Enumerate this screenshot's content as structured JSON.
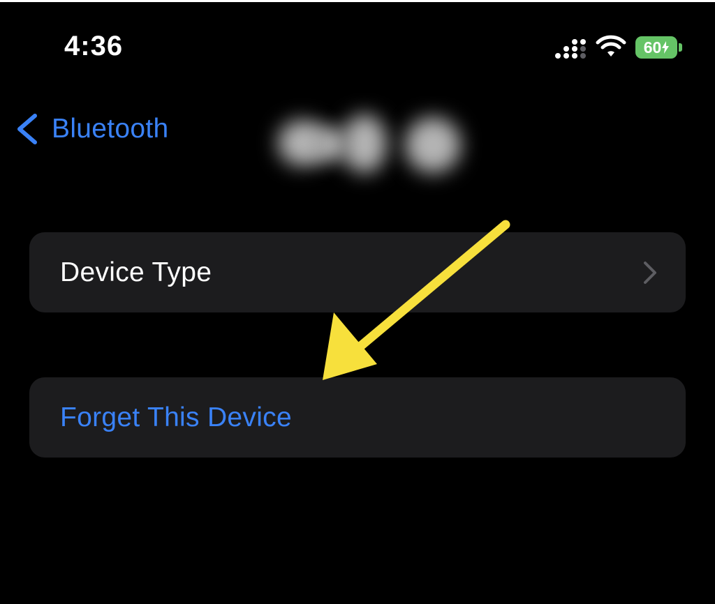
{
  "status_bar": {
    "time": "4:36",
    "battery_percent": "60",
    "signal_icon": "cellular-signal-icon",
    "wifi_icon": "wifi-icon",
    "charging_icon": "bolt-icon"
  },
  "nav": {
    "back_label": "Bluetooth",
    "back_icon": "chevron-left-icon"
  },
  "cells": {
    "device_type": {
      "label": "Device Type",
      "accessory_icon": "chevron-right-icon"
    },
    "forget": {
      "label": "Forget This Device"
    }
  },
  "annotation": {
    "arrow_icon": "arrow-annotation-icon"
  },
  "colors": {
    "background": "#000000",
    "cell_background": "#1c1c1e",
    "ios_blue": "#3a82f7",
    "battery_green": "#65c466",
    "annotation_yellow": "#f7e03c",
    "secondary_gray": "#5d5d62"
  }
}
